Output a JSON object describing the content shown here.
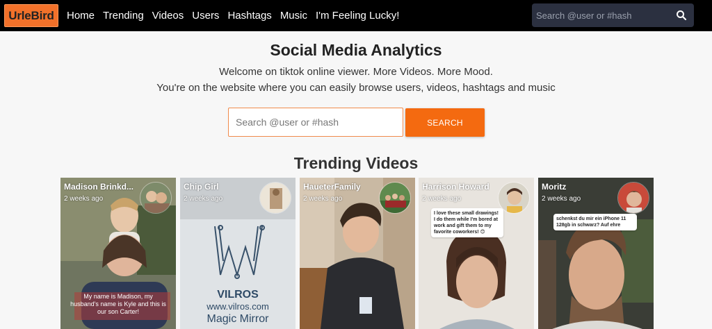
{
  "brand": "UrleBird",
  "nav": {
    "links": [
      "Home",
      "Trending",
      "Videos",
      "Users",
      "Hashtags",
      "Music",
      "I'm Feeling Lucky!"
    ],
    "search_placeholder": "Search @user or #hash"
  },
  "hero": {
    "title": "Social Media Analytics",
    "line1": "Welcome on tiktok online viewer. More Videos. More Mood.",
    "line2": "You're on the website where you can easily browse users, videos, hashtags and music",
    "search_placeholder": "Search @user or #hash",
    "search_button": "SEARCH"
  },
  "trending": {
    "title": "Trending Videos",
    "videos": [
      {
        "user": "Madison Brinkd...",
        "time": "2 weeks ago",
        "caption": "My name is Madison, my husband's name is Kyle and this is our son Carter!"
      },
      {
        "user": "Chip Girl",
        "time": "2 weeks ago",
        "caption": "VILROS",
        "caption2": "www.vilros.com",
        "caption3": "Magic Mirror"
      },
      {
        "user": "HaueterFamily",
        "time": "2 weeks ago"
      },
      {
        "user": "Harrison Howard",
        "time": "2 weeks ago",
        "caption": "I love these small drawings! I do them while I'm bored at work and gift them to my favorite coworkers! 😊"
      },
      {
        "user": "Moritz",
        "time": "2 weeks ago",
        "caption": "schenkst du mir ein iPhone 11 128gb in schwarz? Auf ehre"
      }
    ]
  },
  "colors": {
    "brand": "#f2712a",
    "accent": "#f46a10",
    "navbar": "#000000"
  }
}
